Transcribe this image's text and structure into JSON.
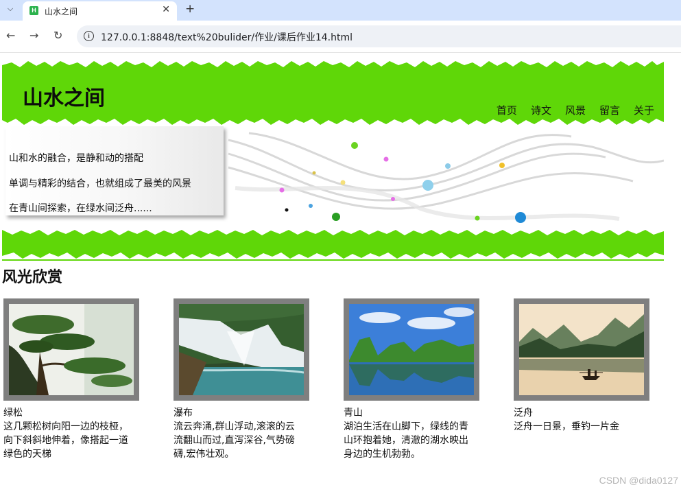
{
  "browser": {
    "tab_title": "山水之间",
    "tab_favicon": "H",
    "url": "127.0.0.1:8848/text%20bulider/作业/课后作业14.html",
    "icons": [
      "chevron-down-icon",
      "close-icon",
      "plus-icon",
      "back-arrow-icon",
      "forward-arrow-icon",
      "reload-icon",
      "info-icon"
    ]
  },
  "header": {
    "title": "山水之间",
    "nav": [
      "首页",
      "诗文",
      "风景",
      "留言",
      "关于"
    ],
    "color": "#5fd708"
  },
  "banner": {
    "lines": [
      "山和水的融合，是静和动的搭配",
      "单调与精彩的结合，也就组成了最美的风景",
      "在青山间探索，在绿水间泛舟......"
    ]
  },
  "section": {
    "title": "风光欣赏"
  },
  "gallery": [
    {
      "name": "绿松",
      "desc": "这几颗松树向阳一边的枝桠，向下斜斜地伸着，像搭起一道绿色的天梯",
      "image": "pine-tree"
    },
    {
      "name": "瀑布",
      "desc": "流云奔涌,群山浮动,滚滚的云流翻山而过,直泻深谷,气势磅礴,宏伟壮观。",
      "image": "waterfall"
    },
    {
      "name": "青山",
      "desc": "湖泊生活在山脚下，绿线的青山环抱着她，清澈的湖水映出身边的生机勃勃。",
      "image": "green-mountain-lake"
    },
    {
      "name": "泛舟",
      "desc": "泛舟一日景，垂钓一片金",
      "image": "boat-on-river"
    }
  ],
  "watermark": "CSDN @dida0127"
}
